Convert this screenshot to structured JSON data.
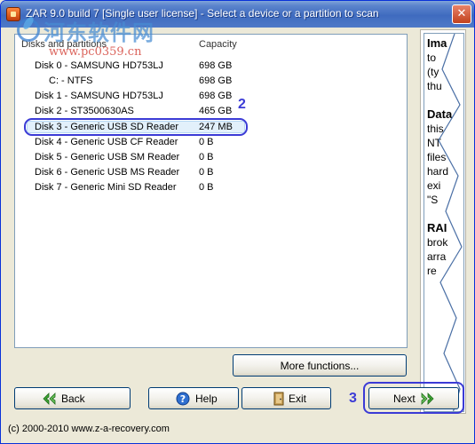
{
  "window": {
    "title": "ZAR 9.0 build 7 [Single user license] - Select a device or a partition to scan",
    "close_glyph": "✕"
  },
  "watermark": {
    "title": "河东软件网",
    "url": "www.pc0359.cn"
  },
  "list": {
    "headers": {
      "name": "Disks and partitions",
      "capacity": "Capacity"
    },
    "rows": [
      {
        "name": "Disk 0 - SAMSUNG HD753LJ",
        "capacity": "698 GB"
      },
      {
        "name": "C: - NTFS",
        "capacity": "698 GB"
      },
      {
        "name": "Disk 1 - SAMSUNG HD753LJ",
        "capacity": "698 GB"
      },
      {
        "name": "Disk 2 - ST3500630AS",
        "capacity": "465 GB"
      },
      {
        "name": "Disk 3 - Generic USB SD Reader",
        "capacity": "247 MB"
      },
      {
        "name": "Disk 4 - Generic USB CF Reader",
        "capacity": "0 B"
      },
      {
        "name": "Disk 5 - Generic USB SM Reader",
        "capacity": "0 B"
      },
      {
        "name": "Disk 6 - Generic USB MS Reader",
        "capacity": "0 B"
      },
      {
        "name": "Disk 7 - Generic Mini SD Reader",
        "capacity": "0 B"
      }
    ],
    "selected_row": 4
  },
  "annotations": {
    "step2": "2",
    "step3": "3"
  },
  "side_panel": {
    "lines": [
      "Ima",
      "to",
      "(ty",
      "thu",
      "",
      "Data",
      "this",
      "NT",
      "files",
      "hard",
      "exi",
      "\"S",
      "",
      "RAI",
      "brok",
      "arra",
      "re"
    ]
  },
  "buttons": {
    "more": "More functions...",
    "back": "Back",
    "help": "Help",
    "exit": "Exit",
    "next": "Next"
  },
  "footer": "(c) 2000-2010 www.z-a-recovery.com",
  "colors": {
    "annotation": "#3b3bd6",
    "title_bar": "#3f6bbf",
    "selection": "#e2f0fb"
  }
}
